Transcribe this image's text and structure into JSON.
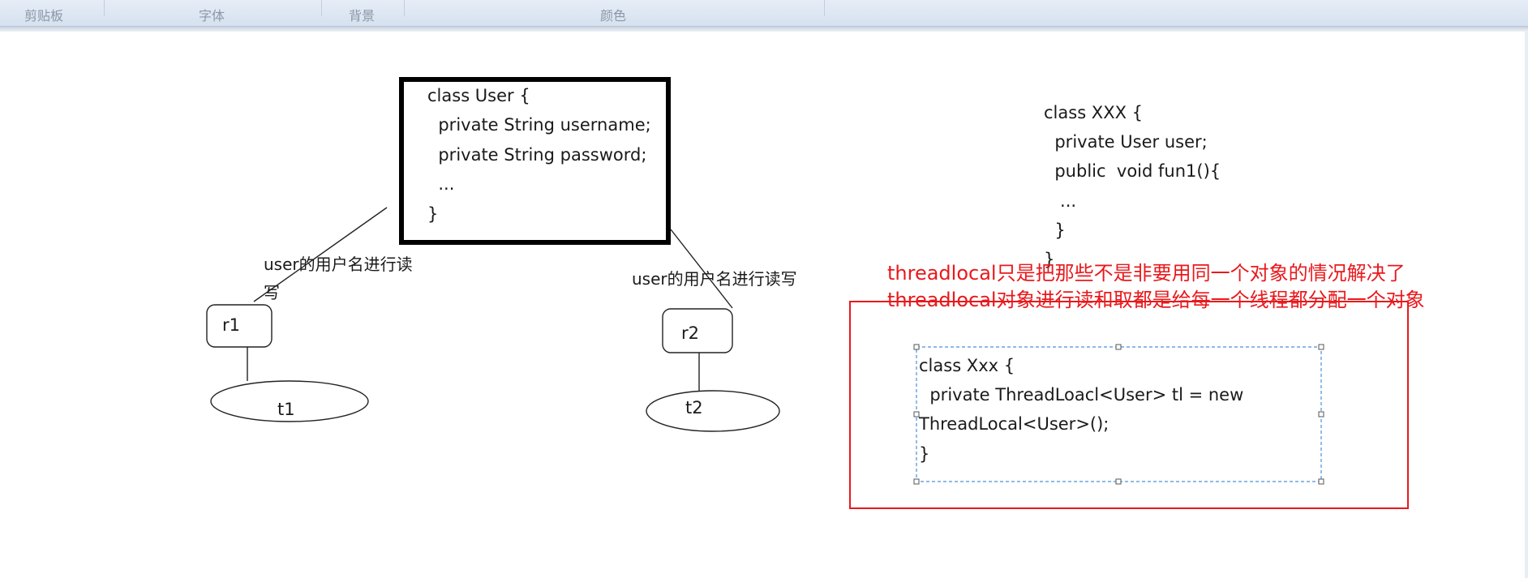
{
  "ribbon": {
    "groups": [
      "剪贴板",
      "字体",
      "背景",
      "颜色"
    ]
  },
  "diagram": {
    "user_class_lines": [
      "class User {",
      "  private String username;",
      "  private String password;",
      "  ...",
      "}"
    ],
    "xxx_class_lines": [
      "class XXX {",
      "  private User user;",
      "  public  void fun1(){",
      "   ...",
      "  }",
      "}"
    ],
    "label_left_line1": "user的用户名进行读",
    "label_left_line2": "写",
    "label_right": "user的用户名进行读写",
    "r1": "r1",
    "r2": "r2",
    "t1": "t1",
    "t2": "t2",
    "note_line1": "threadlocal只是把那些不是非要用同一个对象的情况解决了",
    "note_line2": "threadlocal对象进行读和取都是给每一个线程都分配一个对象",
    "xxx_threadlocal_lines": [
      "class Xxx {",
      "  private ThreadLoacl<User> tl = new",
      "ThreadLocal<User>();",
      "}"
    ]
  },
  "colors": {
    "note_red": "#e8191c",
    "selection_blue": "#4a90d9"
  }
}
